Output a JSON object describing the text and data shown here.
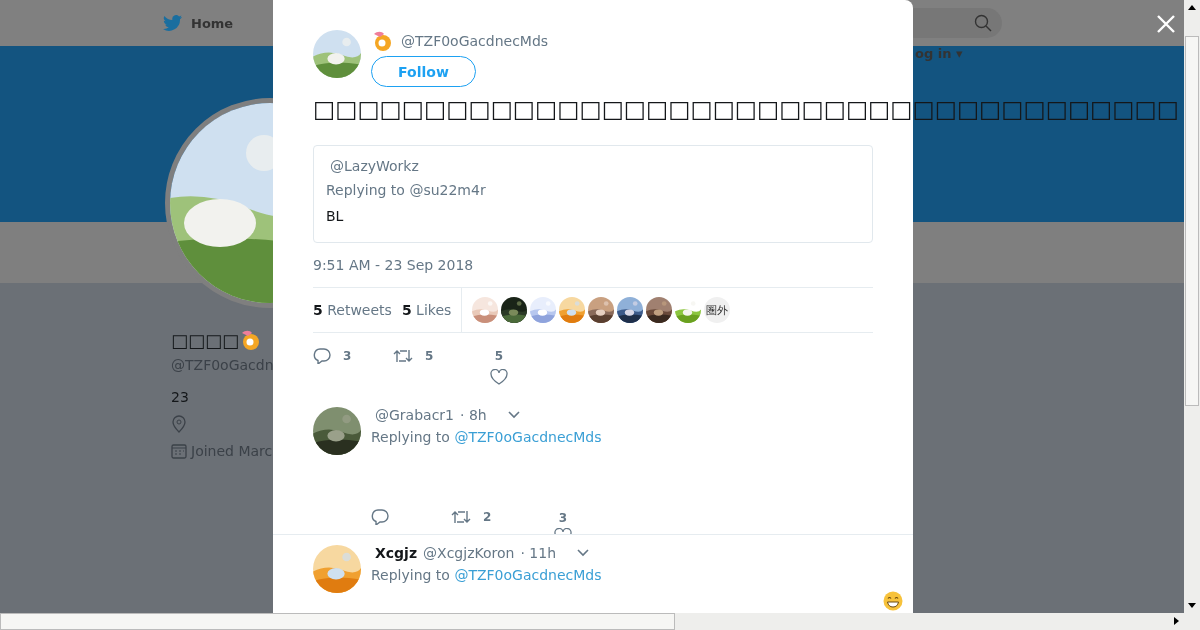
{
  "nav": {
    "home": "Home",
    "login": "og in ▾"
  },
  "profile": {
    "name": "□□□□",
    "handle": "@TZF0oGacdn",
    "bio": "23",
    "joined": "Joined Marc"
  },
  "tweet": {
    "handle": "@TZF0oGacdnecMds",
    "follow": "Follow",
    "text": "□□□□□□□□□□□□□□□□□□□□□□□□□□□□□□□□□□□□□□□",
    "quote": {
      "handle": "@LazyWorkz",
      "replying": "Replying to @su22m4r",
      "text": "BL"
    },
    "time": "9:51 AM - 23 Sep 2018",
    "retweets": {
      "count": "5",
      "label": "Retweets"
    },
    "likes": {
      "count": "5",
      "label": "Likes"
    },
    "likers": [
      {
        "kind": "picture"
      },
      {
        "kind": "picture"
      },
      {
        "kind": "picture"
      },
      {
        "kind": "picture"
      },
      {
        "kind": "picture"
      },
      {
        "kind": "picture"
      },
      {
        "kind": "picture"
      },
      {
        "kind": "picture"
      },
      {
        "kind": "text",
        "label": "圏外"
      }
    ],
    "actions": {
      "replies": "3",
      "retweets": "5",
      "likes": "5"
    }
  },
  "replies": [
    {
      "handle": "@Grabacr1",
      "time": "· 8h",
      "replying_label": "Replying to",
      "replying_to": "@TZF0oGacdnecMds",
      "actions": {
        "retweets": "2",
        "likes": "3"
      }
    },
    {
      "name": "Xcgjz",
      "handle": "@XcgjzKoron",
      "time": "· 11h",
      "replying_label": "Replying to",
      "replying_to": "@TZF0oGacdnecMds",
      "emoji": true
    }
  ]
}
